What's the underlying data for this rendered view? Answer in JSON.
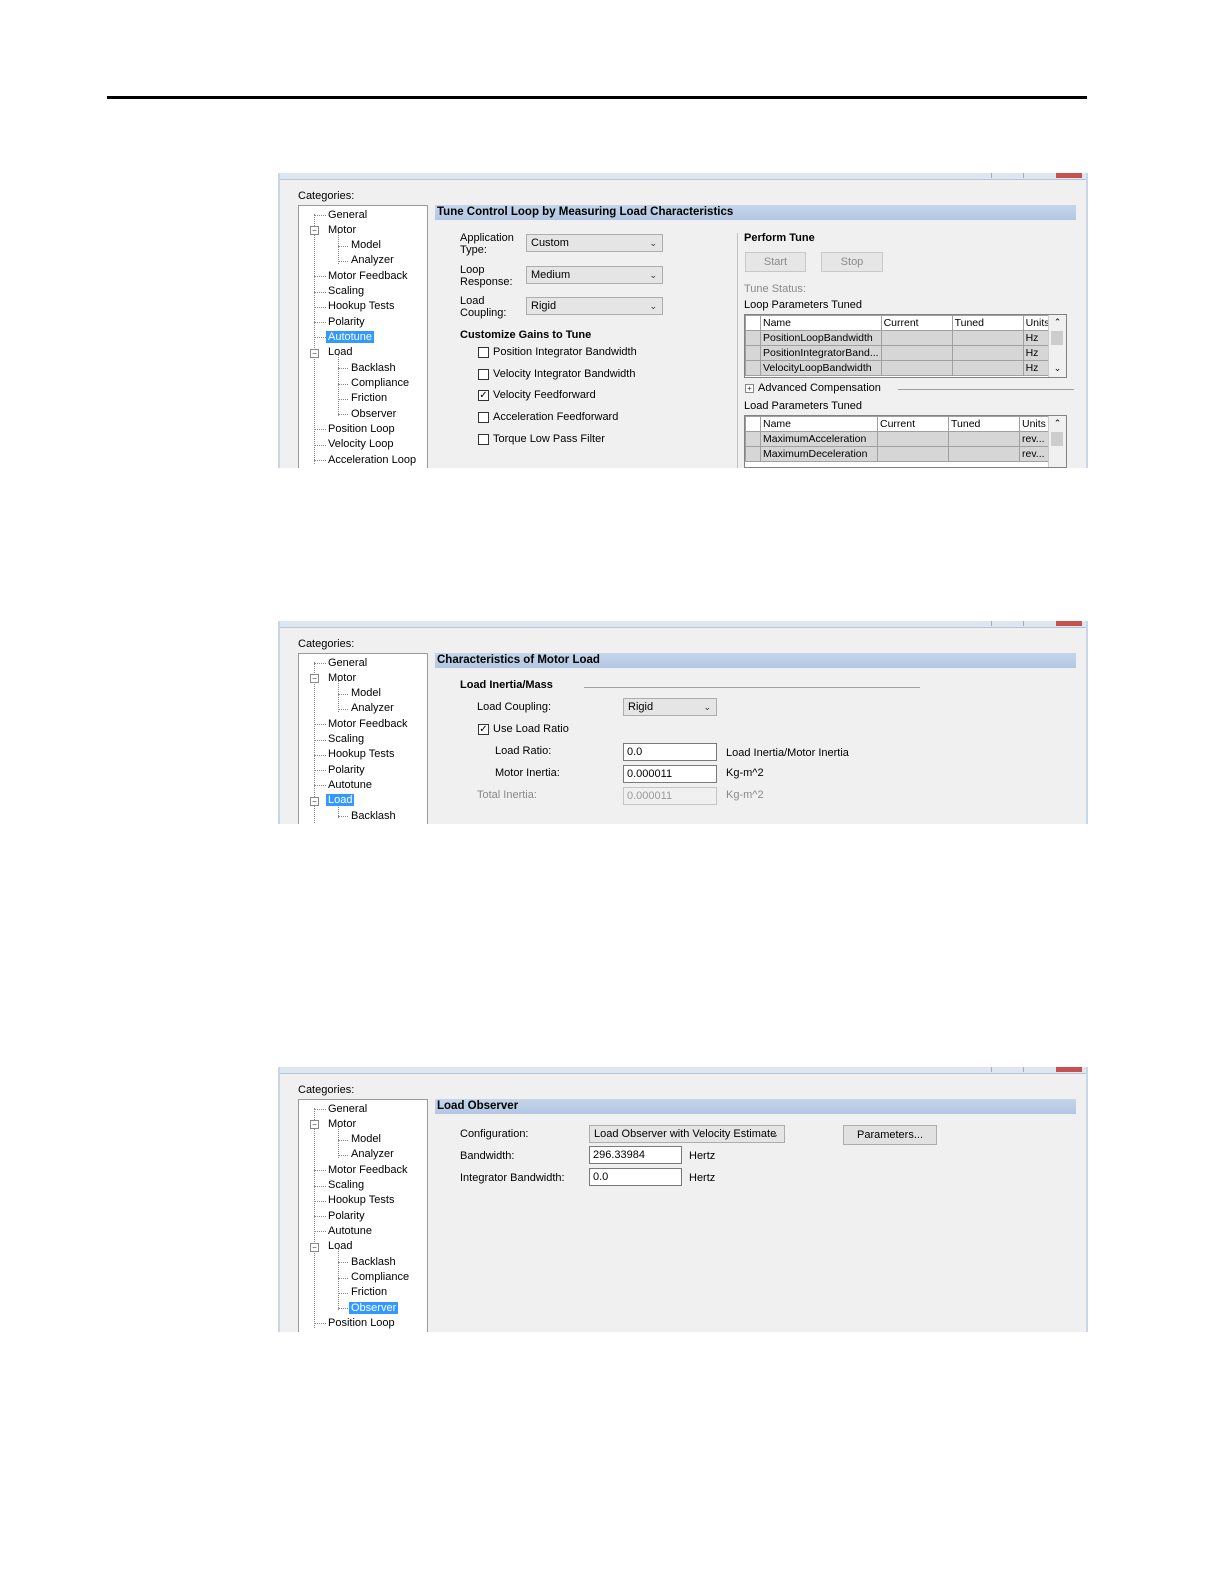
{
  "categories_label": "Categories:",
  "shot1": {
    "tree": [
      "General",
      "Motor",
      "Model",
      "Analyzer",
      "Motor Feedback",
      "Scaling",
      "Hookup Tests",
      "Polarity",
      "Autotune",
      "Load",
      "Backlash",
      "Compliance",
      "Friction",
      "Observer",
      "Position Loop",
      "Velocity Loop",
      "Acceleration Loop"
    ],
    "title": "Tune Control Loop by Measuring Load Characteristics",
    "app_type_label": [
      "Application",
      "Type:"
    ],
    "app_type_value": "Custom",
    "loop_response_label": [
      "Loop",
      "Response:"
    ],
    "loop_response_value": "Medium",
    "load_coupling_label": [
      "Load",
      "Coupling:"
    ],
    "load_coupling_value": "Rigid",
    "customize_heading": "Customize Gains to Tune",
    "gains": [
      {
        "label": "Position Integrator Bandwidth",
        "checked": false
      },
      {
        "label": "Velocity Integrator Bandwidth",
        "checked": false
      },
      {
        "label": "Velocity Feedforward",
        "checked": true
      },
      {
        "label": "Acceleration Feedforward",
        "checked": false
      },
      {
        "label": "Torque Low Pass Filter",
        "checked": false
      }
    ],
    "perform_tune": "Perform Tune",
    "start": "Start",
    "stop": "Stop",
    "tune_status": "Tune Status:",
    "loop_params_label": "Loop Parameters Tuned",
    "columns": [
      "Name",
      "Current",
      "Tuned",
      "Units"
    ],
    "loop_rows": [
      [
        "PositionLoopBandwidth",
        "",
        "",
        "Hz"
      ],
      [
        "PositionIntegratorBand...",
        "",
        "",
        "Hz"
      ],
      [
        "VelocityLoopBandwidth",
        "",
        "",
        "Hz"
      ]
    ],
    "advanced_comp": "Advanced Compensation",
    "load_params_label": "Load Parameters Tuned",
    "load_rows": [
      [
        "MaximumAcceleration",
        "",
        "",
        "rev..."
      ],
      [
        "MaximumDeceleration",
        "",
        "",
        "rev..."
      ]
    ]
  },
  "shot2": {
    "tree": [
      "General",
      "Motor",
      "Model",
      "Analyzer",
      "Motor Feedback",
      "Scaling",
      "Hookup Tests",
      "Polarity",
      "Autotune",
      "Load",
      "Backlash"
    ],
    "title": "Characteristics of Motor Load",
    "group": "Load Inertia/Mass",
    "load_coupling_label": "Load Coupling:",
    "load_coupling_value": "Rigid",
    "use_load_ratio": "Use Load Ratio",
    "load_ratio_label": "Load Ratio:",
    "load_ratio_value": "0.0",
    "load_ratio_unit": "Load Inertia/Motor Inertia",
    "motor_inertia_label": "Motor Inertia:",
    "motor_inertia_value": "0.000011",
    "motor_inertia_unit": "Kg-m^2",
    "total_inertia_label": "Total Inertia:",
    "total_inertia_value": "0.000011",
    "total_inertia_unit": "Kg-m^2"
  },
  "shot3": {
    "tree": [
      "General",
      "Motor",
      "Model",
      "Analyzer",
      "Motor Feedback",
      "Scaling",
      "Hookup Tests",
      "Polarity",
      "Autotune",
      "Load",
      "Backlash",
      "Compliance",
      "Friction",
      "Observer",
      "Position Loop"
    ],
    "title": "Load Observer",
    "config_label": "Configuration:",
    "config_value": "Load Observer with Velocity Estimate",
    "parameters_btn": "Parameters...",
    "bandwidth_label": "Bandwidth:",
    "bandwidth_value": "296.33984",
    "bandwidth_unit": "Hertz",
    "int_bandwidth_label": "Integrator Bandwidth:",
    "int_bandwidth_value": "0.0",
    "int_bandwidth_unit": "Hertz"
  }
}
